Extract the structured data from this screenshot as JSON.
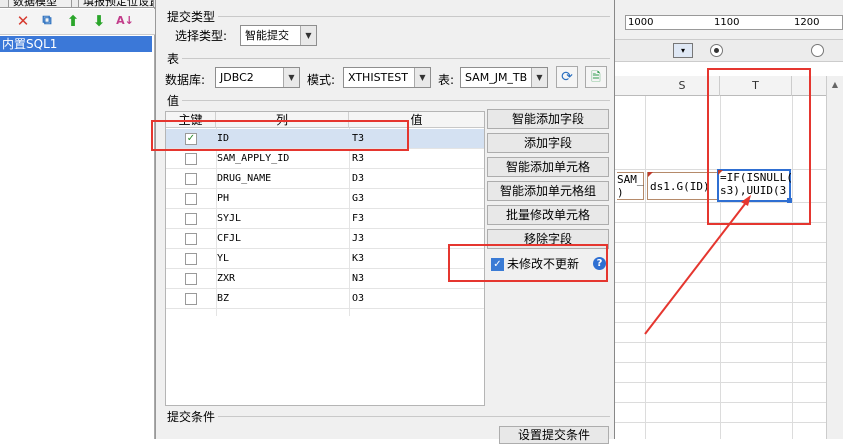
{
  "left_tabs": [
    "数据模型",
    "填报预定位设置"
  ],
  "left_tree": {
    "selected": "内置SQL1"
  },
  "spreadsheet": {
    "ruler_numbers": [
      "1000",
      "1100",
      "1200"
    ],
    "columns": [
      "S",
      "T"
    ],
    "cells": {
      "partial_left": "SAM_\n)",
      "s_cell": "ds1.G(ID)",
      "t_cell": "=IF(ISNULL(\ns3),UUID(3"
    }
  },
  "dialog": {
    "submit_type_group": "提交类型",
    "submit_type_label": "选择类型:",
    "submit_type_value": "智能提交",
    "table_group": "表",
    "db_label": "数据库:",
    "db_value": "JDBC2",
    "schema_label": "模式:",
    "schema_value": "XTHISTEST",
    "table_label": "表:",
    "table_value": "SAM_JM_TB",
    "value_group": "值",
    "table": {
      "headers": [
        "主键",
        "列",
        "值"
      ],
      "rows": [
        {
          "key": true,
          "column": "ID",
          "value": "T3"
        },
        {
          "key": false,
          "column": "SAM_APPLY_ID",
          "value": "R3"
        },
        {
          "key": false,
          "column": "DRUG_NAME",
          "value": "D3"
        },
        {
          "key": false,
          "column": "PH",
          "value": "G3"
        },
        {
          "key": false,
          "column": "SYJL",
          "value": "F3"
        },
        {
          "key": false,
          "column": "CFJL",
          "value": "J3"
        },
        {
          "key": false,
          "column": "YL",
          "value": "K3"
        },
        {
          "key": false,
          "column": "ZXR",
          "value": "N3"
        },
        {
          "key": false,
          "column": "BZ",
          "value": "O3"
        }
      ]
    },
    "buttons": {
      "smart_add_field": "智能添加字段",
      "add_field": "添加字段",
      "smart_add_cell": "智能添加单元格",
      "smart_add_cell_group": "智能添加单元格组",
      "batch_modify_cell": "批量修改单元格",
      "remove_field": "移除字段"
    },
    "no_update_unmodified": {
      "label": "未修改不更新",
      "checked": true
    },
    "condition_group": "提交条件",
    "set_condition_button": "设置提交条件"
  },
  "colors": {
    "highlight": "#e5362f",
    "selection": "#3b78d8",
    "accent": "#2f6fd2"
  }
}
